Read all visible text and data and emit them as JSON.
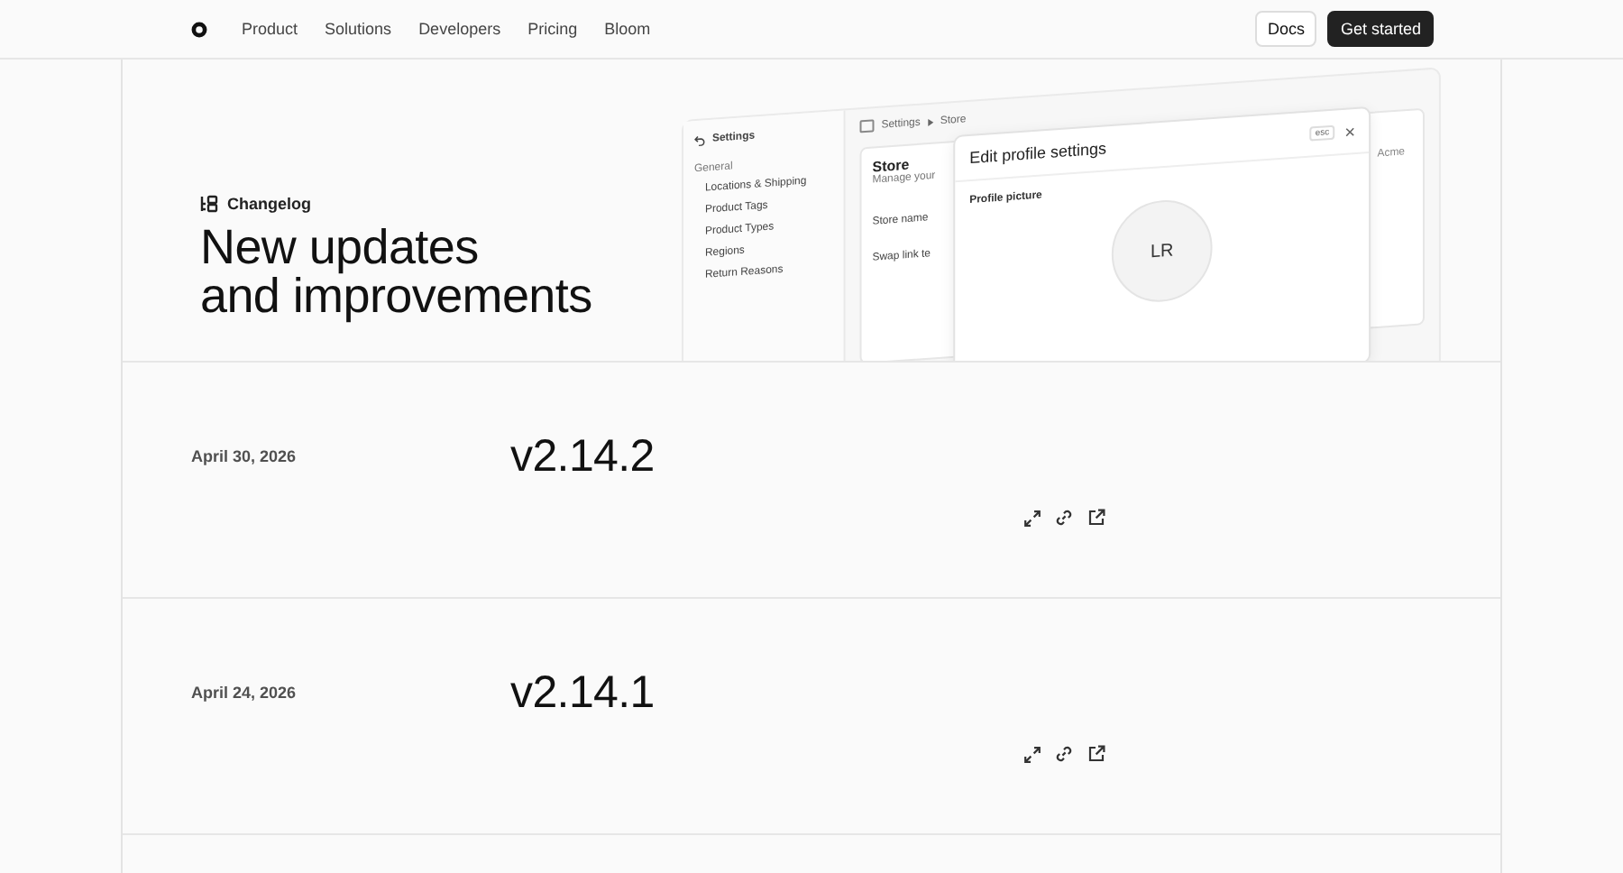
{
  "nav": {
    "links": [
      "Product",
      "Solutions",
      "Developers",
      "Pricing",
      "Bloom"
    ],
    "docs": "Docs",
    "cta": "Get started"
  },
  "hero": {
    "badge": "Changelog",
    "title_lines": [
      "New updates",
      "and improvements"
    ]
  },
  "mockup": {
    "sidebar_title": "Settings",
    "section": "General",
    "items": [
      "Locations & Shipping",
      "Product Tags",
      "Product Types",
      "Regions",
      "Return Reasons"
    ],
    "breadcrumb": [
      "Settings",
      "Store"
    ],
    "store_title": "Store",
    "store_subtitle": "Manage your",
    "fields": [
      "Store name",
      "Swap link te"
    ],
    "side_text": "Acme",
    "dialog": {
      "title": "Edit profile settings",
      "esc": "esc",
      "label": "Profile picture",
      "avatar": "LR"
    }
  },
  "entries": [
    {
      "date": "April 30, 2026",
      "version": "v2.14.2"
    },
    {
      "date": "April 24, 2026",
      "version": "v2.14.1"
    }
  ]
}
